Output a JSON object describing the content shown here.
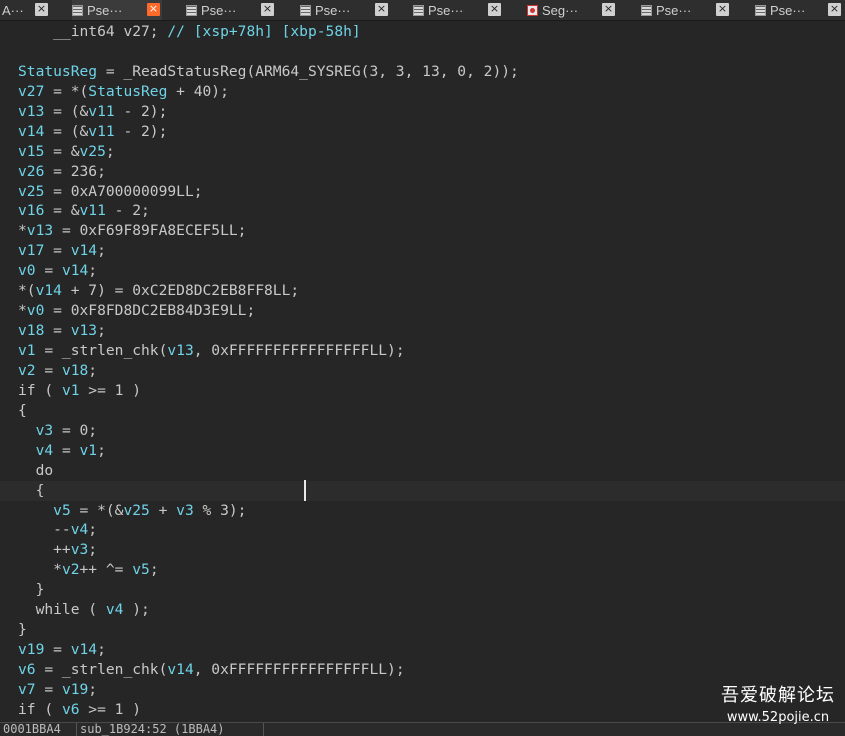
{
  "tabs": [
    {
      "label": "A···",
      "icon": "none",
      "active": false
    },
    {
      "label": "Pse···",
      "icon": "pseudocode-icon",
      "active": true
    },
    {
      "label": "Pse···",
      "icon": "pseudocode-icon",
      "active": false
    },
    {
      "label": "Pse···",
      "icon": "pseudocode-icon",
      "active": false
    },
    {
      "label": "Pse···",
      "icon": "pseudocode-icon",
      "active": false
    },
    {
      "label": "Seg···",
      "icon": "segments-icon",
      "active": false
    },
    {
      "label": "Pse···",
      "icon": "pseudocode-icon",
      "active": false
    },
    {
      "label": "Pse···",
      "icon": "pseudocode-icon",
      "active": false
    }
  ],
  "tab_close_glyph": "×",
  "code_lines": [
    [
      [
        "    ",
        "n"
      ],
      [
        "__int64 v27; ",
        "n"
      ],
      [
        "// [xsp+78h] [xbp-58h]",
        "cm"
      ]
    ],
    [
      [
        "",
        ""
      ]
    ],
    [
      [
        "StatusReg",
        "v"
      ],
      [
        " = _ReadStatusReg(ARM64_SYSREG(3, 3, 13, 0, 2));",
        "n"
      ]
    ],
    [
      [
        "v27",
        "v"
      ],
      [
        " = *(",
        "n"
      ],
      [
        "StatusReg",
        "v"
      ],
      [
        " + 40);",
        "n"
      ]
    ],
    [
      [
        "v13",
        "v"
      ],
      [
        " = (&",
        "n"
      ],
      [
        "v11",
        "v"
      ],
      [
        " - 2);",
        "n"
      ]
    ],
    [
      [
        "v14",
        "v"
      ],
      [
        " = (&",
        "n"
      ],
      [
        "v11",
        "v"
      ],
      [
        " - 2);",
        "n"
      ]
    ],
    [
      [
        "v15",
        "v"
      ],
      [
        " = &",
        "n"
      ],
      [
        "v25",
        "v"
      ],
      [
        ";",
        "n"
      ]
    ],
    [
      [
        "v26",
        "v"
      ],
      [
        " = 236;",
        "n"
      ]
    ],
    [
      [
        "v25",
        "v"
      ],
      [
        " = 0xA700000099LL;",
        "n"
      ]
    ],
    [
      [
        "v16",
        "v"
      ],
      [
        " = &",
        "n"
      ],
      [
        "v11",
        "v"
      ],
      [
        " - 2;",
        "n"
      ]
    ],
    [
      [
        "*",
        "n"
      ],
      [
        "v13",
        "v"
      ],
      [
        " = 0xF69F89FA8ECEF5LL;",
        "n"
      ]
    ],
    [
      [
        "v17",
        "v"
      ],
      [
        " = ",
        "n"
      ],
      [
        "v14",
        "v"
      ],
      [
        ";",
        "n"
      ]
    ],
    [
      [
        "v0",
        "v"
      ],
      [
        " = ",
        "n"
      ],
      [
        "v14",
        "v"
      ],
      [
        ";",
        "n"
      ]
    ],
    [
      [
        "*(",
        "n"
      ],
      [
        "v14",
        "v"
      ],
      [
        " + 7) = 0xC2ED8DC2EB8FF8LL;",
        "n"
      ]
    ],
    [
      [
        "*",
        "n"
      ],
      [
        "v0",
        "v"
      ],
      [
        " = 0xF8FD8DC2EB84D3E9LL;",
        "n"
      ]
    ],
    [
      [
        "v18",
        "v"
      ],
      [
        " = ",
        "n"
      ],
      [
        "v13",
        "v"
      ],
      [
        ";",
        "n"
      ]
    ],
    [
      [
        "v1",
        "v"
      ],
      [
        " = _strlen_chk(",
        "n"
      ],
      [
        "v13",
        "v"
      ],
      [
        ", 0xFFFFFFFFFFFFFFFFLL);",
        "n"
      ]
    ],
    [
      [
        "v2",
        "v"
      ],
      [
        " = ",
        "n"
      ],
      [
        "v18",
        "v"
      ],
      [
        ";",
        "n"
      ]
    ],
    [
      [
        "if ( ",
        "n"
      ],
      [
        "v1",
        "v"
      ],
      [
        " >= 1 )",
        "n"
      ]
    ],
    [
      [
        "{",
        "n"
      ]
    ],
    [
      [
        "  ",
        "n"
      ],
      [
        "v3",
        "v"
      ],
      [
        " = 0;",
        "n"
      ]
    ],
    [
      [
        "  ",
        "n"
      ],
      [
        "v4",
        "v"
      ],
      [
        " = ",
        "n"
      ],
      [
        "v1",
        "v"
      ],
      [
        ";",
        "n"
      ]
    ],
    [
      [
        "  do",
        "n"
      ]
    ],
    [
      [
        "  {",
        "n"
      ]
    ],
    [
      [
        "    ",
        "n"
      ],
      [
        "v5",
        "v"
      ],
      [
        " = *(&",
        "n"
      ],
      [
        "v25",
        "v"
      ],
      [
        " + ",
        "n"
      ],
      [
        "v3",
        "v"
      ],
      [
        " % 3);",
        "n"
      ]
    ],
    [
      [
        "    --",
        "n"
      ],
      [
        "v4",
        "v"
      ],
      [
        ";",
        "n"
      ]
    ],
    [
      [
        "    ++",
        "n"
      ],
      [
        "v3",
        "v"
      ],
      [
        ";",
        "n"
      ]
    ],
    [
      [
        "    *",
        "n"
      ],
      [
        "v2",
        "v"
      ],
      [
        "++ ^= ",
        "n"
      ],
      [
        "v5",
        "v"
      ],
      [
        ";",
        "n"
      ]
    ],
    [
      [
        "  }",
        "n"
      ]
    ],
    [
      [
        "  while ( ",
        "n"
      ],
      [
        "v4",
        "v"
      ],
      [
        " );",
        "n"
      ]
    ],
    [
      [
        "}",
        "n"
      ]
    ],
    [
      [
        "v19",
        "v"
      ],
      [
        " = ",
        "n"
      ],
      [
        "v14",
        "v"
      ],
      [
        ";",
        "n"
      ]
    ],
    [
      [
        "v6",
        "v"
      ],
      [
        " = _strlen_chk(",
        "n"
      ],
      [
        "v14",
        "v"
      ],
      [
        ", 0xFFFFFFFFFFFFFFFFLL);",
        "n"
      ]
    ],
    [
      [
        "v7",
        "v"
      ],
      [
        " = ",
        "n"
      ],
      [
        "v19",
        "v"
      ],
      [
        ";",
        "n"
      ]
    ],
    [
      [
        "if ( ",
        "n"
      ],
      [
        "v6",
        "v"
      ],
      [
        " >= 1 )",
        "n"
      ]
    ]
  ],
  "cursor_line": 23,
  "status": {
    "address": "0001BBA4",
    "location": "sub_1B924:52 (1BBA4)"
  },
  "watermark": {
    "title": "吾爱破解论坛",
    "url": "www.52pojie.cn"
  },
  "colors": {
    "background": "#262626",
    "variable": "#6fd3e8",
    "text": "#c8c8c8",
    "active_tab_close": "#ff6a2a"
  }
}
